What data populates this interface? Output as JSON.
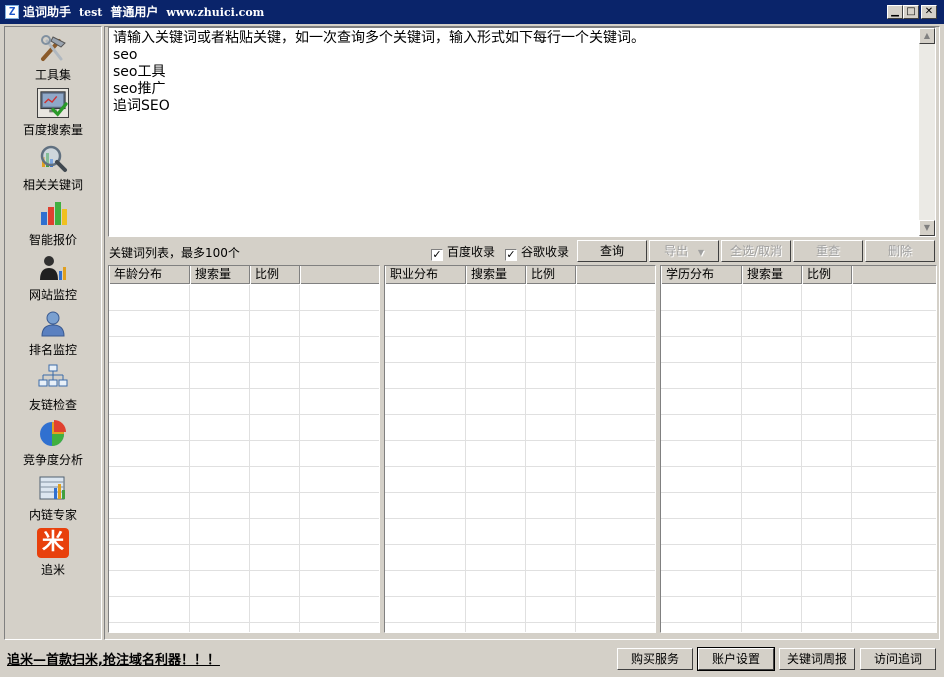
{
  "window": {
    "app_name": "追词助手",
    "user": "test",
    "user_type": "普通用户",
    "site": "www.zhuici.com",
    "app_icon_letter": "Z"
  },
  "sidebar": {
    "items": [
      {
        "label": "工具集",
        "icon": "tools-icon"
      },
      {
        "label": "百度搜索量",
        "icon": "monitor-check-icon",
        "active": true
      },
      {
        "label": "相关关键词",
        "icon": "magnifier-icon"
      },
      {
        "label": "智能报价",
        "icon": "bar-chart-icon"
      },
      {
        "label": "网站监控",
        "icon": "person-chart-icon"
      },
      {
        "label": "排名监控",
        "icon": "user-icon"
      },
      {
        "label": "友链检查",
        "icon": "network-icon"
      },
      {
        "label": "竞争度分析",
        "icon": "pie-chart-icon"
      },
      {
        "label": "内链专家",
        "icon": "document-chart-icon"
      },
      {
        "label": "追米",
        "icon": "zhuimi-logo-icon",
        "glyph": "米"
      }
    ]
  },
  "query": {
    "text": "请输入关键词或者粘贴关键，如一次查询多个关键词，输入形式如下每行一个关键词。\nseo\nseo工具\nseo推广\n追词SEO"
  },
  "toolbar": {
    "list_label": "关键词列表，最多100个",
    "baidu_index_label": "百度收录",
    "google_index_label": "谷歌收录",
    "query_button": "查询",
    "export_button": "导出",
    "select_all_button": "全选/取消",
    "dedupe_button": "重查",
    "delete_button": "删除"
  },
  "tables": [
    {
      "columns": [
        "年龄分布",
        "搜索量",
        "比例",
        ""
      ]
    },
    {
      "columns": [
        "职业分布",
        "搜索量",
        "比例",
        ""
      ]
    },
    {
      "columns": [
        "学历分布",
        "搜索量",
        "比例",
        ""
      ]
    }
  ],
  "status": {
    "promo": "追米—首款扫米,抢注域名利器！！！",
    "buy_button": "购买服务",
    "account_button": "账户设置",
    "report_button": "关键词周报",
    "visit_button": "访问追词"
  },
  "colors": {
    "titlebar": "#0a246a",
    "face": "#d4d0c8"
  }
}
